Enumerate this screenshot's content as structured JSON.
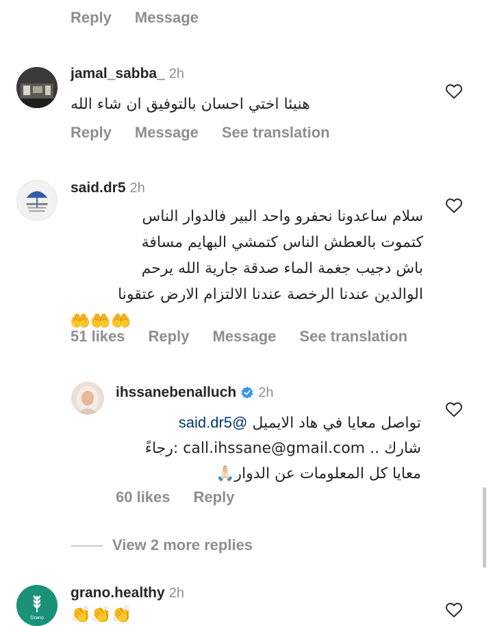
{
  "colors": {
    "text": "#262626",
    "muted": "#8e8e8e",
    "link": "#00376b",
    "verified": "#3897f0"
  },
  "top_actions": {
    "reply": "Reply",
    "message": "Message"
  },
  "comments": [
    {
      "username": "jamal_sabba_",
      "time": "2h",
      "text": "هنيئا اختي احسان بالتوفيق ان شاء الله",
      "reply": "Reply",
      "message": "Message",
      "translate": "See translation"
    },
    {
      "username": "said.dr5",
      "time": "2h",
      "lines": [
        "سلام ساعدونا نحفرو واحد البير فالدوار الناس",
        "كتموت بالعطش الناس كتمشي البهايم مسافة",
        "باش دجيب جغمة الماء  صدقة جارية الله يرحم",
        "الوالدين عندنا الرخصة عندنا الالتزام الارض عتقونا"
      ],
      "emoji_line": "🤲🤲🤲",
      "likes": "51 likes",
      "reply": "Reply",
      "message": "Message",
      "translate": "See translation"
    }
  ],
  "reply_comment": {
    "username": "ihssanebenalluch",
    "time": "2h",
    "mention": "@said.dr5",
    "line1": "تواصل معايا في هاد الايميل",
    "line2": "شارك .. call.ihssane@gmail.com :رجاءً",
    "line3": "معايا كل المعلومات عن الدوار🙏🏻",
    "likes": "60 likes",
    "reply": "Reply"
  },
  "view_more": "View 2 more replies",
  "last_comment": {
    "username": "grano.healthy",
    "time": "2h",
    "emoji_line": "👏👏👏",
    "avatar_text": "Grano"
  }
}
